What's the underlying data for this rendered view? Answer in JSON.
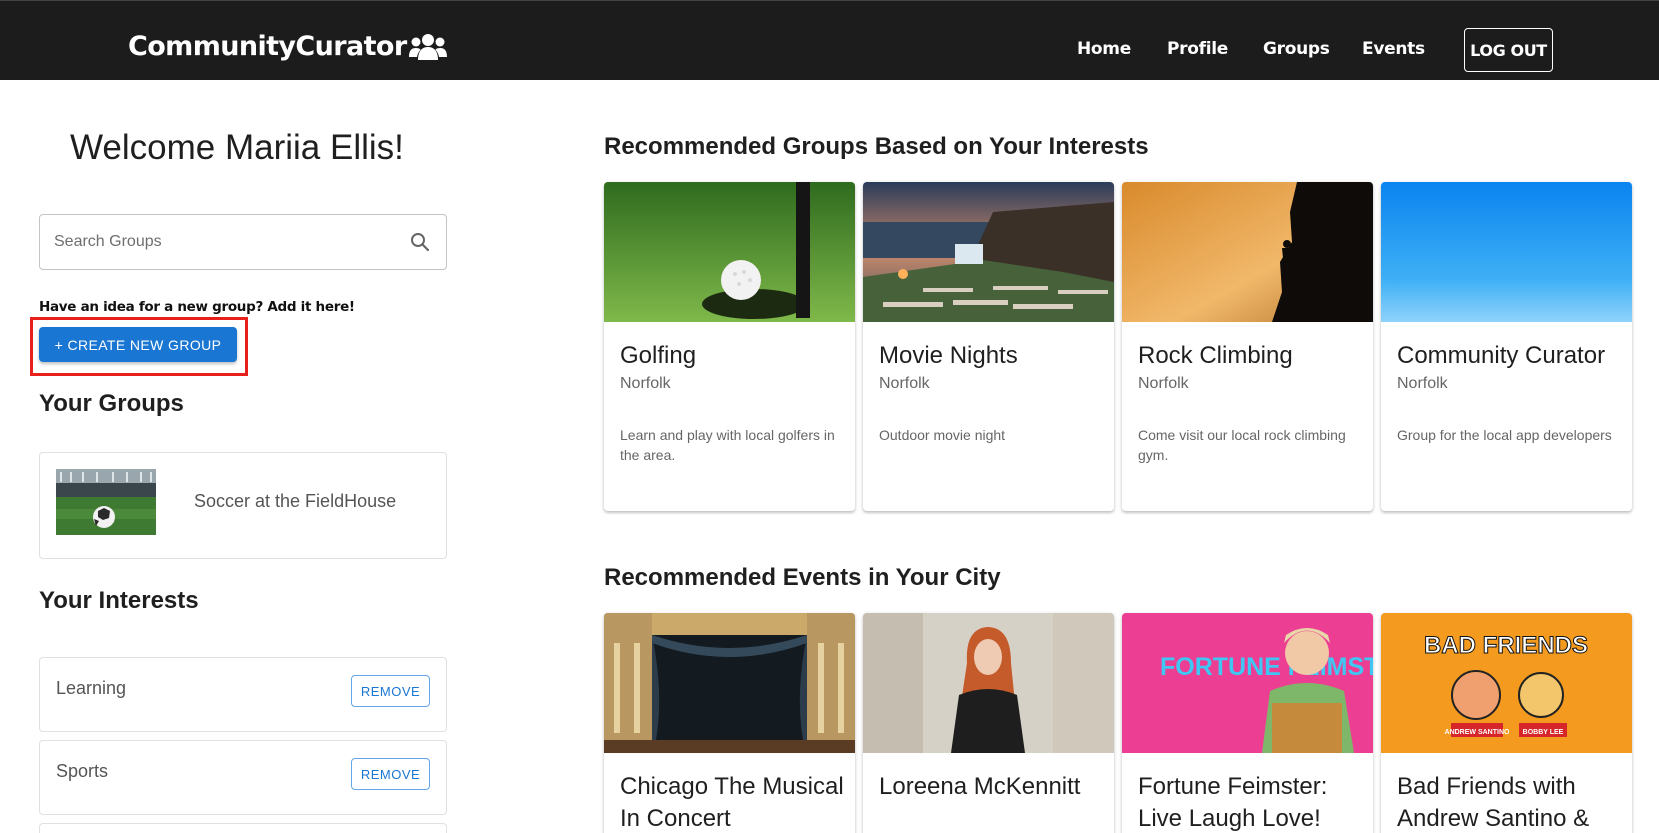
{
  "navbar": {
    "brand": "CommunityCurator",
    "brand_icon": "users-icon",
    "links": [
      {
        "label": "Home"
      },
      {
        "label": "Profile"
      },
      {
        "label": "Groups"
      },
      {
        "label": "Events"
      }
    ],
    "logout_label": "LOG OUT"
  },
  "sidebar": {
    "welcome": "Welcome Mariia Ellis!",
    "search_placeholder": "Search Groups",
    "idea_text": "Have an idea for a new group? Add it here!",
    "create_button": "+ CREATE NEW GROUP",
    "your_groups_title": "Your Groups",
    "groups": [
      {
        "name": "Soccer at the FieldHouse"
      }
    ],
    "your_interests_title": "Your Interests",
    "interests": [
      {
        "label": "Learning",
        "action": "REMOVE"
      },
      {
        "label": "Sports",
        "action": "REMOVE"
      }
    ]
  },
  "recommended_groups": {
    "title": "Recommended Groups Based on Your Interests",
    "items": [
      {
        "title": "Golfing",
        "location": "Norfolk",
        "description": "Learn and play with local golfers in the area."
      },
      {
        "title": "Movie Nights",
        "location": "Norfolk",
        "description": "Outdoor movie night"
      },
      {
        "title": "Rock Climbing",
        "location": "Norfolk",
        "description": "Come visit our local rock climbing gym."
      },
      {
        "title": "Community Curator",
        "location": "Norfolk",
        "description": "Group for the local app developers"
      }
    ]
  },
  "recommended_events": {
    "title": "Recommended Events in Your City",
    "items": [
      {
        "title": "Chicago The Musical In Concert"
      },
      {
        "title": "Loreena McKennitt"
      },
      {
        "title": "Fortune Feimster: Live Laugh Love!",
        "poster_text": "FORTUNE FEIMSTER"
      },
      {
        "title": "Bad Friends with Andrew Santino &",
        "poster_text": "BAD FRIENDS",
        "poster_names": [
          "ANDREW SANTINO",
          "BOBBY LEE"
        ]
      }
    ]
  },
  "colors": {
    "navbar_bg": "#1c1c1c",
    "primary": "#1976d2",
    "highlight": "#e8201c"
  }
}
